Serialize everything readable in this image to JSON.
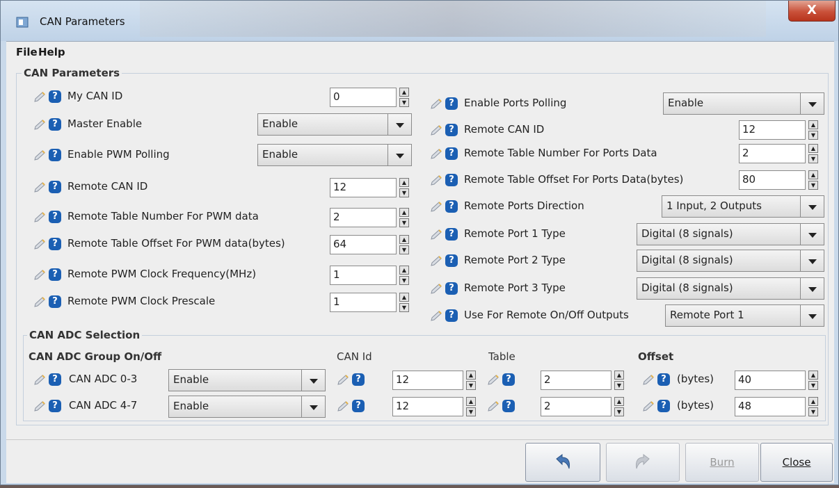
{
  "window": {
    "title": "CAN Parameters",
    "close_label": "X"
  },
  "menu": {
    "file": "File",
    "help": "Help"
  },
  "can_parameters": {
    "legend": "CAN Parameters",
    "left": [
      {
        "label": "My CAN ID",
        "type": "spin",
        "value": "0"
      },
      {
        "label": "Master Enable",
        "type": "combo",
        "value": "Enable"
      },
      {
        "label": "Enable PWM Polling",
        "type": "combo",
        "value": "Enable"
      },
      {
        "label": "Remote CAN ID",
        "type": "spin",
        "value": "12"
      },
      {
        "label": "Remote Table Number For PWM data",
        "type": "spin",
        "value": "2"
      },
      {
        "label": "Remote Table Offset For PWM data(bytes)",
        "type": "spin",
        "value": "64"
      },
      {
        "label": "Remote PWM Clock Frequency(MHz)",
        "type": "spin",
        "value": "1"
      },
      {
        "label": "Remote PWM Clock Prescale",
        "type": "spin",
        "value": "1"
      }
    ],
    "right": [
      {
        "label": "Enable Ports Polling",
        "type": "combo",
        "value": "Enable"
      },
      {
        "label": "Remote CAN ID",
        "type": "spin",
        "value": "12"
      },
      {
        "label": "Remote Table Number For Ports Data",
        "type": "spin",
        "value": "2"
      },
      {
        "label": "Remote Table Offset For Ports Data(bytes)",
        "type": "spin",
        "value": "80"
      },
      {
        "label": "Remote Ports Direction",
        "type": "combo",
        "value": "1 Input, 2 Outputs"
      },
      {
        "label": "Remote Port 1 Type",
        "type": "combo",
        "value": "Digital (8 signals)"
      },
      {
        "label": "Remote Port 2 Type",
        "type": "combo",
        "value": "Digital (8 signals)"
      },
      {
        "label": "Remote Port 3 Type",
        "type": "combo",
        "value": "Digital (8 signals)"
      },
      {
        "label": "Use For Remote On/Off Outputs",
        "type": "combo",
        "value": "Remote Port 1"
      }
    ]
  },
  "adc": {
    "legend": "CAN ADC Selection",
    "headers": {
      "group": "CAN ADC Group On/Off",
      "canid": "CAN Id",
      "table": "Table",
      "offset": "Offset"
    },
    "rows": [
      {
        "label": "CAN ADC 0-3",
        "onoff": "Enable",
        "canid": "12",
        "table": "2",
        "bytes_label": "(bytes)",
        "offset": "40"
      },
      {
        "label": "CAN ADC 4-7",
        "onoff": "Enable",
        "canid": "12",
        "table": "2",
        "bytes_label": "(bytes)",
        "offset": "48"
      }
    ]
  },
  "buttons": {
    "undo_icon": "undo-arrow-icon",
    "redo_icon": "redo-arrow-icon",
    "burn": "Burn",
    "close": "Close"
  },
  "colors": {
    "help_icon": "#1b5fb3",
    "close_button": "#c9513a",
    "window_frame": "#c9d9ea"
  }
}
